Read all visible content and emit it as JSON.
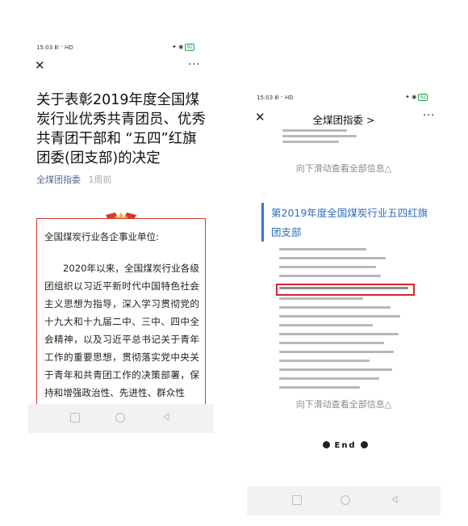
{
  "left": {
    "status_time": "15:03",
    "status_signal": "Ⅱl ᐨ HD",
    "battery": "92",
    "close_glyph": "✕",
    "more_glyph": "···",
    "article_title": "关于表彰2019年度全国煤炭行业优秀共青团员、优秀共青团干部和 “五四”红旗团委(团支部)的决定",
    "author": "全煤团指委",
    "time_ago": "1周前",
    "doc_heading": "全国煤炭行业各企事业单位:",
    "doc_body": "2020年以来，全国煤炭行业各级团组织以习近平新时代中国特色社会主义思想为指导，深入学习贯彻党的十九大和十九届二中、三中、四中全会精神，以及习近平总书记关于青年工作的重要思想，贯彻落实党中央关于青年和共青团工作的决策部署，保持和增强政治性、先进性、群众性"
  },
  "right": {
    "status_time": "15:03",
    "status_signal": "Ⅱl ᐨ HD",
    "battery": "92",
    "close_glyph": "✕",
    "header_title": "全煤团指委 >",
    "more_glyph": "···",
    "scroll_hint_1": "向下滑动查看全部信息△",
    "section_heading": "第2019年度全国煤炭行业五四红旗团支部",
    "scroll_hint_2": "向下滑动查看全部信息△",
    "end_label": "End"
  },
  "nav_icons": [
    "square-icon",
    "circle-icon",
    "back-triangle-icon"
  ],
  "colors": {
    "accent_red": "#d43a2a",
    "link_blue": "#576b95",
    "heading_blue": "#2f6cbf",
    "highlight_red": "#d6252b"
  }
}
